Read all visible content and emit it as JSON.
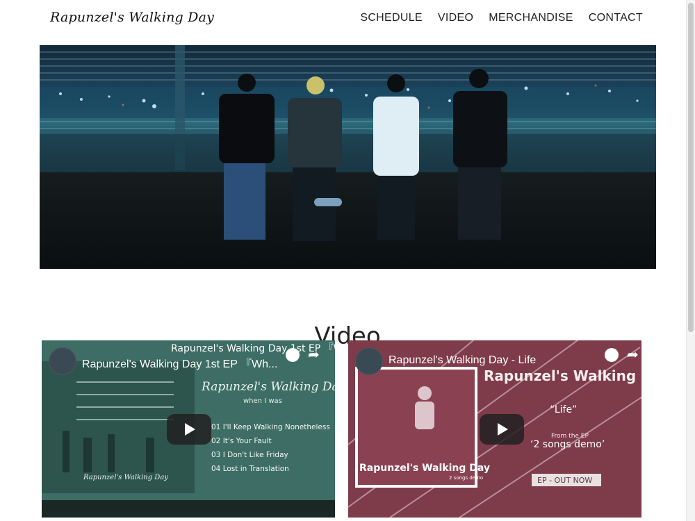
{
  "site": {
    "logo_text": "Rapunzel's Walking Day"
  },
  "nav": {
    "items": [
      "SCHEDULE",
      "VIDEO",
      "MERCHANDISE",
      "CONTACT"
    ]
  },
  "section": {
    "title": "Video"
  },
  "videos": [
    {
      "title": "Rapunzel's Walking Day 1st EP 『Wh...",
      "cover_title": "Rapunzel's Walking Day",
      "cover_subtitle": "when I was",
      "tracks": [
        "01 I'll Keep Walking Nonetheless",
        "02 It's Your Fault",
        "03 I Don't Like Friday",
        "04 Lost in Translation"
      ],
      "inset_text": "Rapunzel's Walking Day"
    },
    {
      "title": "Rapunzel's Walking Day - Life",
      "cover_title": "Rapunzel's Walking Day",
      "song": "“Life”",
      "from_label": "From the EP",
      "ep_name": "‘2 songs demo’",
      "cta": "EP - OUT NOW",
      "inset_title": "Rapunzel's Walking Day",
      "inset_sub": "2 songs demo"
    }
  ]
}
